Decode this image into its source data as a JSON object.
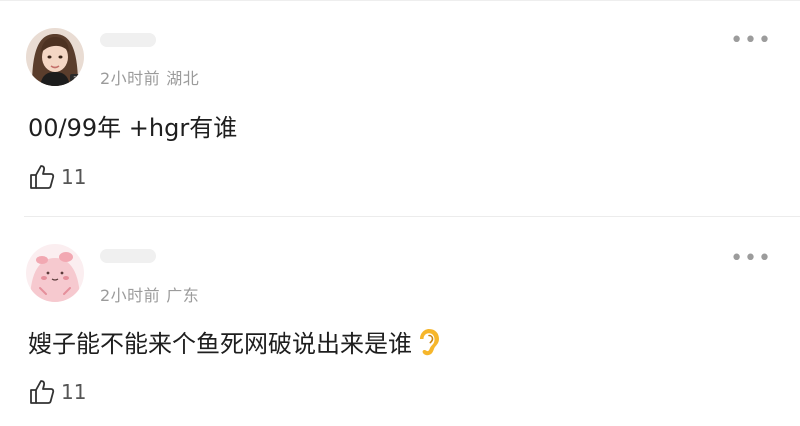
{
  "comments": [
    {
      "time": "2小时前",
      "location": "湖北",
      "text": "00/99年 +hgr有谁",
      "likes": "11",
      "avatar_icon": "girl-portrait-avatar",
      "more_icon": "more-dots-icon"
    },
    {
      "time": "2小时前",
      "location": "广东",
      "text": "嫂子能不能来个鱼死网破说出来是谁",
      "emoji": "ear-emoji",
      "likes": "11",
      "avatar_icon": "pink-cartoon-avatar",
      "more_icon": "more-dots-icon"
    }
  ],
  "more_label": "•••",
  "colors": {
    "meta": "#9b9b9b",
    "text": "#1e1e1e",
    "divider": "#ececec",
    "avatar_pink": "#f6c9cf"
  }
}
